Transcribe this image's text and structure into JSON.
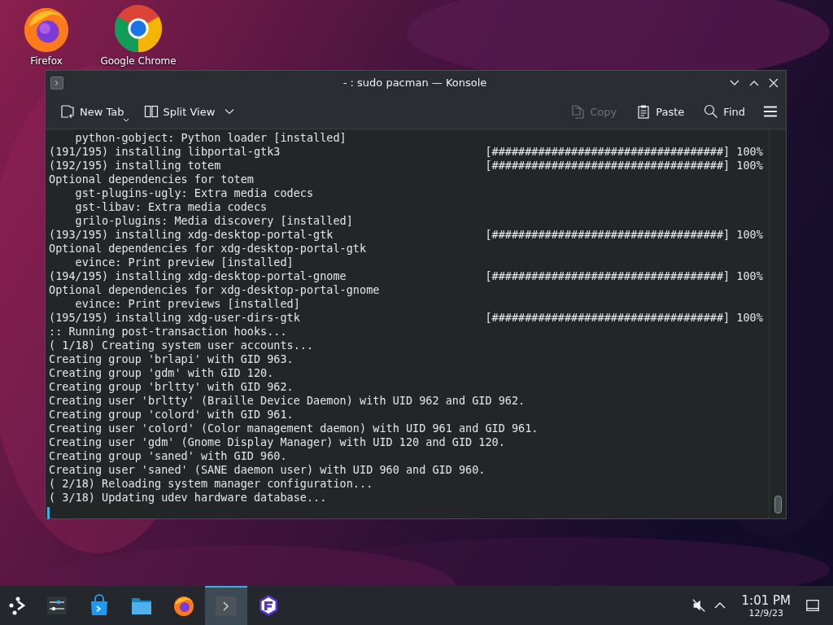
{
  "desktop_icons": [
    {
      "kind": "firefox",
      "label": "Firefox"
    },
    {
      "kind": "chrome",
      "label": "Google Chrome"
    }
  ],
  "window": {
    "title": "- : sudo pacman — Konsole",
    "toolbar": [
      {
        "kind": "new-tab",
        "label": "New Tab",
        "disabled": false
      },
      {
        "kind": "split-view",
        "label": "Split View",
        "disabled": false
      },
      {
        "kind": "copy",
        "label": "Copy",
        "disabled": true
      },
      {
        "kind": "paste",
        "label": "Paste",
        "disabled": false
      },
      {
        "kind": "find",
        "label": "Find",
        "disabled": false
      }
    ],
    "terminal_lines": [
      {
        "text": "    python-gobject: Python loader [installed]"
      },
      {
        "text": "(191/195) installing libportal-gtk3",
        "progress": "[###################################]",
        "percent": "100%"
      },
      {
        "text": "(192/195) installing totem",
        "progress": "[###################################]",
        "percent": "100%"
      },
      {
        "text": "Optional dependencies for totem"
      },
      {
        "text": "    gst-plugins-ugly: Extra media codecs"
      },
      {
        "text": "    gst-libav: Extra media codecs"
      },
      {
        "text": "    grilo-plugins: Media discovery [installed]"
      },
      {
        "text": "(193/195) installing xdg-desktop-portal-gtk",
        "progress": "[###################################]",
        "percent": "100%"
      },
      {
        "text": "Optional dependencies for xdg-desktop-portal-gtk"
      },
      {
        "text": "    evince: Print preview [installed]"
      },
      {
        "text": "(194/195) installing xdg-desktop-portal-gnome",
        "progress": "[###################################]",
        "percent": "100%"
      },
      {
        "text": "Optional dependencies for xdg-desktop-portal-gnome"
      },
      {
        "text": "    evince: Print previews [installed]"
      },
      {
        "text": "(195/195) installing xdg-user-dirs-gtk",
        "progress": "[###################################]",
        "percent": "100%"
      },
      {
        "text": ":: Running post-transaction hooks..."
      },
      {
        "text": "( 1/18) Creating system user accounts..."
      },
      {
        "text": "Creating group 'brlapi' with GID 963."
      },
      {
        "text": "Creating group 'gdm' with GID 120."
      },
      {
        "text": "Creating group 'brltty' with GID 962."
      },
      {
        "text": "Creating user 'brltty' (Braille Device Daemon) with UID 962 and GID 962."
      },
      {
        "text": "Creating group 'colord' with GID 961."
      },
      {
        "text": "Creating user 'colord' (Color management daemon) with UID 961 and GID 961."
      },
      {
        "text": "Creating user 'gdm' (Gnome Display Manager) with UID 120 and GID 120."
      },
      {
        "text": "Creating group 'saned' with GID 960."
      },
      {
        "text": "Creating user 'saned' (SANE daemon user) with UID 960 and GID 960."
      },
      {
        "text": "( 2/18) Reloading system manager configuration..."
      },
      {
        "text": "( 3/18) Updating udev hardware database..."
      }
    ]
  },
  "taskbar": {
    "items": [
      {
        "kind": "launcher",
        "selected": false
      },
      {
        "kind": "settings",
        "selected": false
      },
      {
        "kind": "store",
        "selected": false
      },
      {
        "kind": "files",
        "selected": false
      },
      {
        "kind": "firefox",
        "selected": false
      },
      {
        "kind": "terminal",
        "selected": true
      },
      {
        "kind": "app",
        "selected": false
      }
    ],
    "time": "1:01 PM",
    "date": "12/9/23"
  }
}
